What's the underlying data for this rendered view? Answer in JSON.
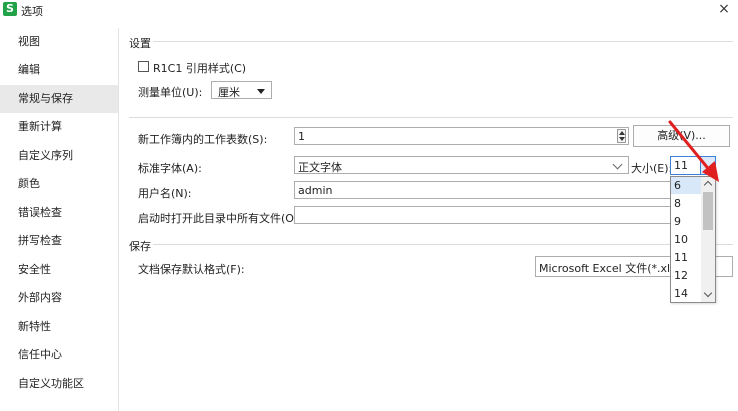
{
  "window": {
    "logo": "S",
    "title": "选项",
    "close_symbol": "×"
  },
  "sidebar": {
    "items": [
      {
        "label": "视图"
      },
      {
        "label": "编辑"
      },
      {
        "label": "常规与保存",
        "active": true
      },
      {
        "label": "重新计算"
      },
      {
        "label": "自定义序列"
      },
      {
        "label": "颜色"
      },
      {
        "label": "错误检查"
      },
      {
        "label": "拼写检查"
      },
      {
        "label": "安全性"
      },
      {
        "label": "外部内容"
      },
      {
        "label": "新特性"
      },
      {
        "label": "信任中心"
      },
      {
        "label": "自定义功能区"
      }
    ]
  },
  "settings": {
    "section_label": "设置",
    "r1c1_label": "R1C1 引用样式(C)",
    "r1c1_checked": false,
    "unit_label": "测量单位(U):",
    "unit_value": "厘米",
    "sheets_label": "新工作簿内的工作表数(S):",
    "sheets_value": "1",
    "advanced_button": "高级(V)...",
    "font_label": "标准字体(A):",
    "font_value": "正文字体",
    "size_label": "大小(E):",
    "size_value": "11",
    "size_options": [
      "6",
      "8",
      "9",
      "10",
      "11",
      "12",
      "14"
    ],
    "username_label": "用户名(N):",
    "username_value": "admin",
    "startup_label": "启动时打开此目录中所有文件(O):",
    "startup_value": ""
  },
  "save": {
    "section_label": "保存",
    "format_label": "文档保存默认格式(F):",
    "format_value": "Microsoft Excel 文件(*.xlsx"
  },
  "colors": {
    "accent": "#3c7fd9",
    "annotation_arrow": "#e02020",
    "logo": "#22a34a"
  }
}
